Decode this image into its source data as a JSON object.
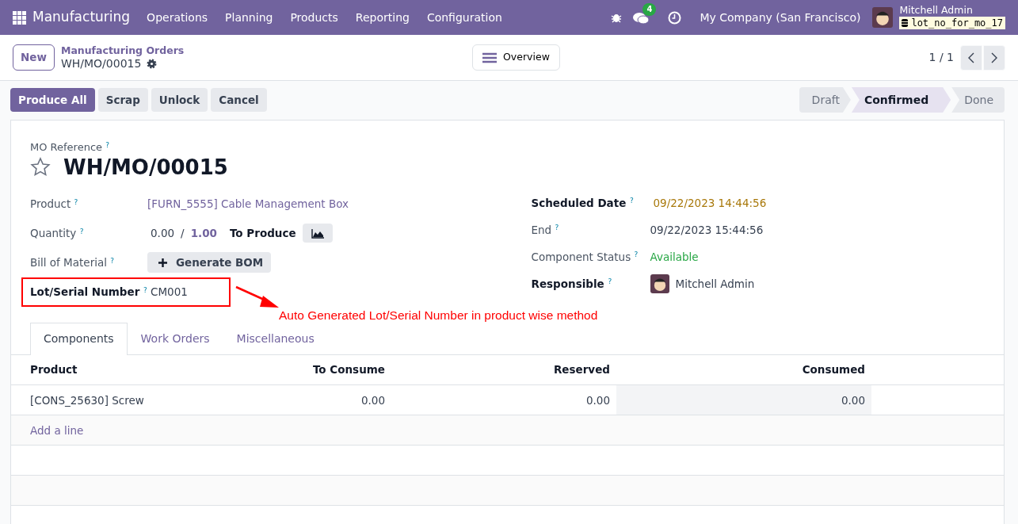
{
  "navbar": {
    "app": "Manufacturing",
    "menus": [
      "Operations",
      "Planning",
      "Products",
      "Reporting",
      "Configuration"
    ],
    "messages_count": "4",
    "company": "My Company (San Francisco)",
    "user": "Mitchell Admin",
    "database": "lot_no_for_mo_17"
  },
  "control_panel": {
    "new_button": "New",
    "breadcrumb": "Manufacturing Orders",
    "record": "WH/MO/00015",
    "overview_button": "Overview",
    "pager": "1 / 1"
  },
  "actions": [
    {
      "label": "Produce All",
      "primary": true
    },
    {
      "label": "Scrap",
      "primary": false
    },
    {
      "label": "Unlock",
      "primary": false
    },
    {
      "label": "Cancel",
      "primary": false
    }
  ],
  "stages": [
    {
      "label": "Draft",
      "selected": false
    },
    {
      "label": "Confirmed",
      "selected": true
    },
    {
      "label": "Done",
      "selected": false
    }
  ],
  "sheet": {
    "reference_label": "MO Reference $^{?}$",
    "reference": "WH/MO/00015",
    "starred": false,
    "left_fields": [
      {
        "label": "Product $^{?}$",
        "required": false,
        "kind": "link",
        "value": "[FURN_5555] Cable Management Box"
      },
      {
        "label": "Quantity $^{?}$",
        "required": false,
        "kind": "quantity",
        "produced": "0.00",
        "separator": "/",
        "value": "1.00",
        "suffix": "To Produce"
      },
      {
        "label": "Bill of Material $^{?}$",
        "required": false,
        "kind": "button",
        "value": "Generate BOM"
      },
      {
        "label": "Lot/Serial Number $^{?}$",
        "required": true,
        "kind": "text",
        "value": "CM001",
        "highlighted": true
      }
    ],
    "right_fields": [
      {
        "label": "Scheduled Date $^{?}$",
        "required": true,
        "kind": "warning",
        "value": "09/22/2023 14:44:56"
      },
      {
        "label": "End $^{?}$",
        "required": false,
        "kind": "text",
        "value": "09/22/2023 15:44:56"
      },
      {
        "label": "Component Status $^{?}$",
        "required": false,
        "kind": "success",
        "value": "Available"
      },
      {
        "label": "Responsible $^{?}$",
        "required": true,
        "kind": "avatar",
        "value": "Mitchell Admin"
      }
    ],
    "annotation": "Auto Generated Lot/Serial Number in product wise method",
    "tabs": [
      {
        "label": "Components",
        "selected": true
      },
      {
        "label": "Work Orders",
        "selected": false
      },
      {
        "label": "Miscellaneous",
        "selected": false
      }
    ],
    "table": {
      "columns": [
        "Product",
        "To Consume",
        "Reserved",
        "Consumed"
      ],
      "rows": [
        [
          "[CONS_25630] Screw",
          "0.00",
          "0.00",
          "0.00"
        ]
      ],
      "add_line": "Add a line"
    }
  }
}
